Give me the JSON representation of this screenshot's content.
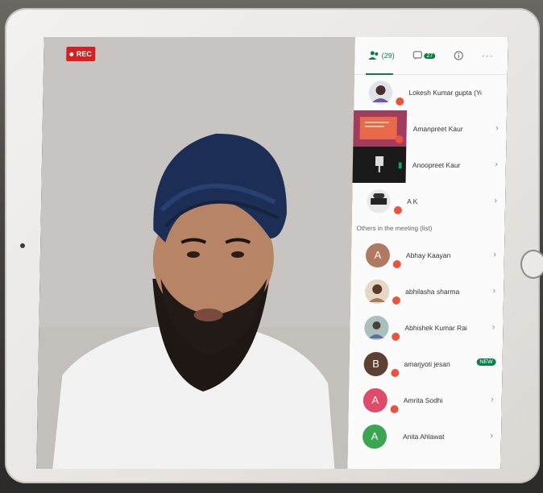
{
  "recording": {
    "label": "REC"
  },
  "tabs": [
    {
      "label": "(29)",
      "icon": "people-icon",
      "active": true
    },
    {
      "label": "",
      "icon": "chat-icon",
      "badge": "27"
    },
    {
      "label": "",
      "icon": "info-icon"
    },
    {
      "label": "",
      "icon": "more-icon"
    }
  ],
  "participants_in_call": [
    {
      "name": "Lokesh Kumar gupta (You)",
      "type": "avatar"
    },
    {
      "name": "Amanpreet Kaur",
      "type": "screen"
    },
    {
      "name": "Anoopreet Kaur",
      "type": "video"
    },
    {
      "name": "A K",
      "type": "avatar"
    }
  ],
  "section_label": "Others in the meeting (list)",
  "participants_other": [
    {
      "name": "Abhay Kaayan",
      "initial": "A",
      "color": "#b07a60"
    },
    {
      "name": "abhilasha sharma",
      "initial": "",
      "color": "#c9a982"
    },
    {
      "name": "Abhishek Kumar Rai",
      "initial": "",
      "color": "#8fa7a3"
    },
    {
      "name": "amarjyoti jesan",
      "initial": "B",
      "color": "#7a5a4a",
      "badge": "NEW"
    },
    {
      "name": "Amrita Sodhi",
      "initial": "A",
      "color": "#e04b6a"
    },
    {
      "name": "Anita Ahlawat",
      "initial": "A",
      "color": "#3aa651"
    }
  ]
}
